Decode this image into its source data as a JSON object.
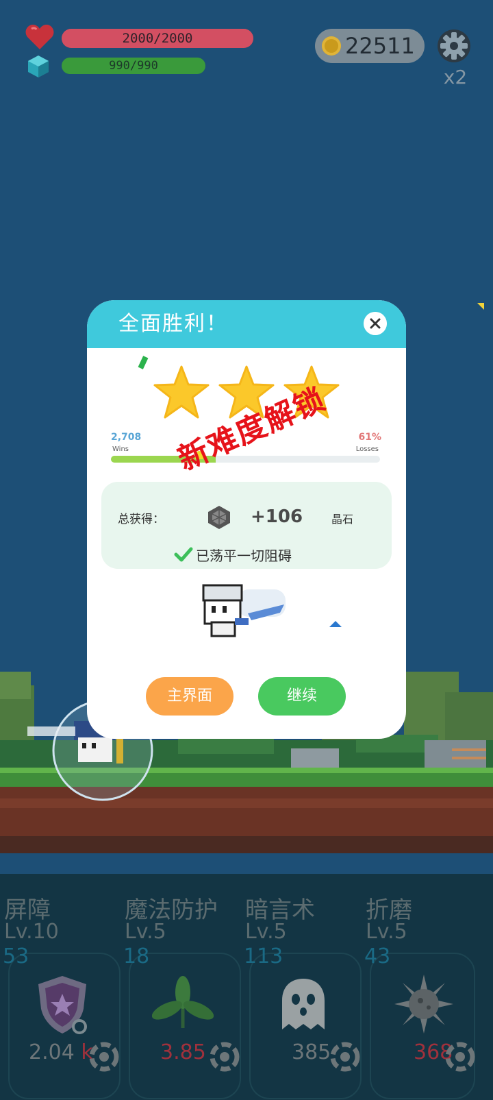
{
  "hud": {
    "hp_text": "2000/2000",
    "hp_fraction": 1.0,
    "mp_text": "990/990",
    "mp_fraction": 1.0,
    "coins": "22511",
    "speed": "x2",
    "icons": [
      "heart-icon",
      "crystal-icon",
      "coin-icon",
      "gear-icon"
    ]
  },
  "dialog": {
    "title": "全面胜利！",
    "stars": 3,
    "wins": "2,708",
    "wins_label": "Wins",
    "losses_pct": "61%",
    "losses_label": "Losses",
    "wins_fraction": 0.39,
    "reward_label": "总获得：",
    "reward_value": "+106",
    "reward_unit": "晶石",
    "clear_text": "已荡平一切阻碍",
    "unlock_stamp": "新难度解锁",
    "btn_home": "主界面",
    "btn_continue": "继续"
  },
  "skills": [
    {
      "name": "屏障",
      "level": "Lv.10",
      "count": "53",
      "cost": "2.04",
      "cost_unit": "k",
      "icon": "shield-star-icon"
    },
    {
      "name": "魔法防护",
      "level": "Lv.5",
      "count": "18",
      "cost": "3.85",
      "cost_unit": "",
      "icon": "leaf-icon"
    },
    {
      "name": "暗言术",
      "level": "Lv.5",
      "count": "113",
      "cost": "385",
      "cost_unit": "",
      "icon": "ghost-icon"
    },
    {
      "name": "折磨",
      "level": "Lv.5",
      "count": "43",
      "cost": "368",
      "cost_unit": "",
      "icon": "spiked-ball-icon"
    }
  ],
  "colors": {
    "sky": "#1d4f76",
    "dialog_header": "#3fc9dc",
    "home_button": "#fba54a",
    "continue_button": "#49c95f",
    "stamp": "#e6131a"
  }
}
